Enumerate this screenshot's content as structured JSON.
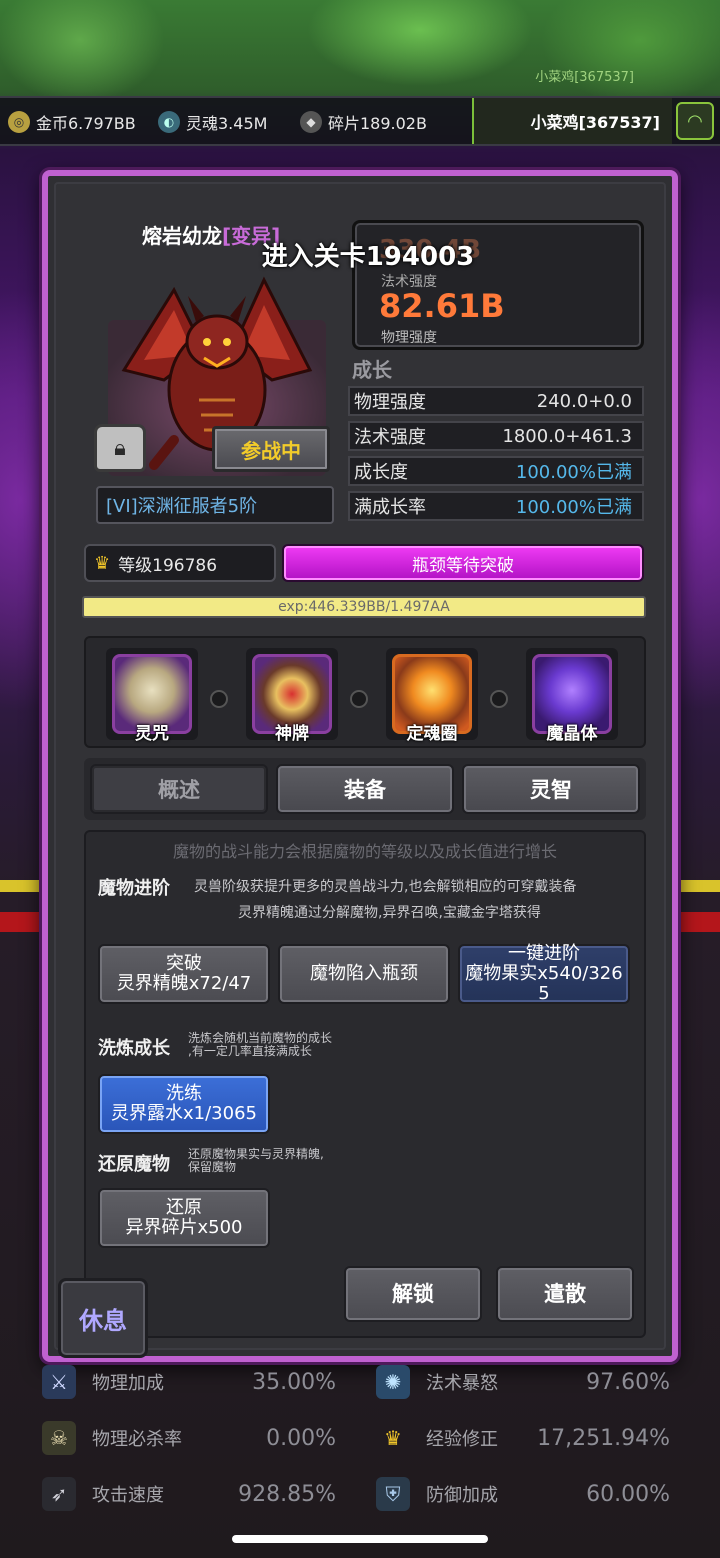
{
  "resources": {
    "gold": "金币6.797BB",
    "soul": "灵魂3.45M",
    "shard": "碎片189.02B"
  },
  "player": {
    "name": "小菜鸡[367537]",
    "bg_name": "小菜鸡[367537]"
  },
  "toast": "进入关卡194003",
  "monster": {
    "name": "熔岩幼龙",
    "variant": "[变异]",
    "battle_label": "参战中",
    "title": "[VI]深渊征服者5阶"
  },
  "power": {
    "magic_value_faded": "330.4B",
    "magic_label": "法术强度",
    "physical_value": "82.61B",
    "physical_label": "物理强度"
  },
  "growth": {
    "title": "成长",
    "rows": [
      {
        "label": "物理强度",
        "value": "240.0+0.0"
      },
      {
        "label": "法术强度",
        "value": "1800.0+461.3"
      },
      {
        "label": "成长度",
        "value": "100.00%已满"
      },
      {
        "label": "满成长率",
        "value": "100.00%已满"
      }
    ]
  },
  "level": {
    "label": "等级196786",
    "bottleneck": "瓶颈等待突破",
    "exp": "exp:446.339BB/1.497AA"
  },
  "equipment": [
    {
      "label": "灵咒",
      "icon": "scroll-icon"
    },
    {
      "label": "神牌",
      "icon": "star-emblem-icon"
    },
    {
      "label": "定魂圈",
      "icon": "fire-ring-icon"
    },
    {
      "label": "魔晶体",
      "icon": "crystal-skull-icon"
    }
  ],
  "tabs": [
    "概述",
    "装备",
    "灵智"
  ],
  "content": {
    "header": "魔物的战斗能力会根据魔物的等级以及成长值进行增长",
    "advance": {
      "title": "魔物进阶",
      "note1": "灵兽阶级获提升更多的灵兽战斗力,也会解锁相应的可穿戴装备",
      "note2": "灵界精魄通过分解魔物,异界召唤,宝藏金字塔获得",
      "btn_break_1": "突破",
      "btn_break_2": "灵界精魄x72/47",
      "btn_trapped": "魔物陷入瓶颈",
      "btn_oneclick_1": "一键进阶",
      "btn_oneclick_2": "魔物果实x540/326",
      "btn_oneclick_3": "5"
    },
    "refine": {
      "title": "洗炼成长",
      "note1": "洗炼会随机当前魔物的成长",
      "note2": ",有一定几率直接满成长",
      "btn_1": "洗练",
      "btn_2": "灵界露水x1/3065"
    },
    "restore": {
      "title": "还原魔物",
      "note1": "还原魔物果实与灵界精魄,",
      "note2": "保留魔物",
      "btn_1": "还原",
      "btn_2": "异界碎片x500"
    },
    "unlock": "解锁",
    "dismiss": "遣散"
  },
  "rest": "休息",
  "bottom_stats": [
    {
      "label": "物理加成",
      "value": "35.00%",
      "icon": "sword-icon"
    },
    {
      "label": "法术暴怒",
      "value": "97.60%",
      "icon": "orb-icon"
    },
    {
      "label": "物理必杀率",
      "value": "0.00%",
      "icon": "skull-icon"
    },
    {
      "label": "经验修正",
      "value": "17,251.94%",
      "icon": "crown-icon"
    },
    {
      "label": "攻击速度",
      "value": "928.85%",
      "icon": "blade-icon"
    },
    {
      "label": "防御加成",
      "value": "60.00%",
      "icon": "shield-icon"
    }
  ],
  "colors": {
    "dialog_border": "#c061d0",
    "bottleneck": "#e030f0",
    "orange_power": "#ff7a3a",
    "blue_value": "#55b8ea",
    "gold": "#f3cc2a"
  }
}
